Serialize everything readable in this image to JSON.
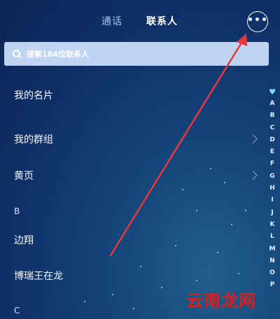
{
  "header": {
    "tabs": [
      {
        "label": "通话",
        "active": false
      },
      {
        "label": "联系人",
        "active": true
      }
    ],
    "more_icon": "more-horizontal-icon",
    "more_label": "•••"
  },
  "search": {
    "label": "搜索184位联系人",
    "icon": "search-icon"
  },
  "list": {
    "items": [
      {
        "label": "我的名片",
        "chevron": false
      },
      {
        "label": "我的群组",
        "chevron": true
      },
      {
        "label": "黄页",
        "chevron": true
      }
    ],
    "sections": [
      {
        "letter": "B",
        "contacts": [
          "边翔",
          "博瑞王在龙"
        ]
      },
      {
        "letter": "C",
        "contacts": []
      }
    ]
  },
  "index_bar": {
    "top_icon": "heart-icon",
    "letters": [
      "A",
      "B",
      "C",
      "D",
      "E",
      "F",
      "G",
      "H",
      "I",
      "J",
      "K",
      "L",
      "M",
      "N",
      "O",
      "P"
    ]
  },
  "colors": {
    "accent_arrow": "#e8373a",
    "search_bg": "#bfd3f2",
    "watermark": "#d81f1f"
  },
  "watermark": "云南龙网"
}
